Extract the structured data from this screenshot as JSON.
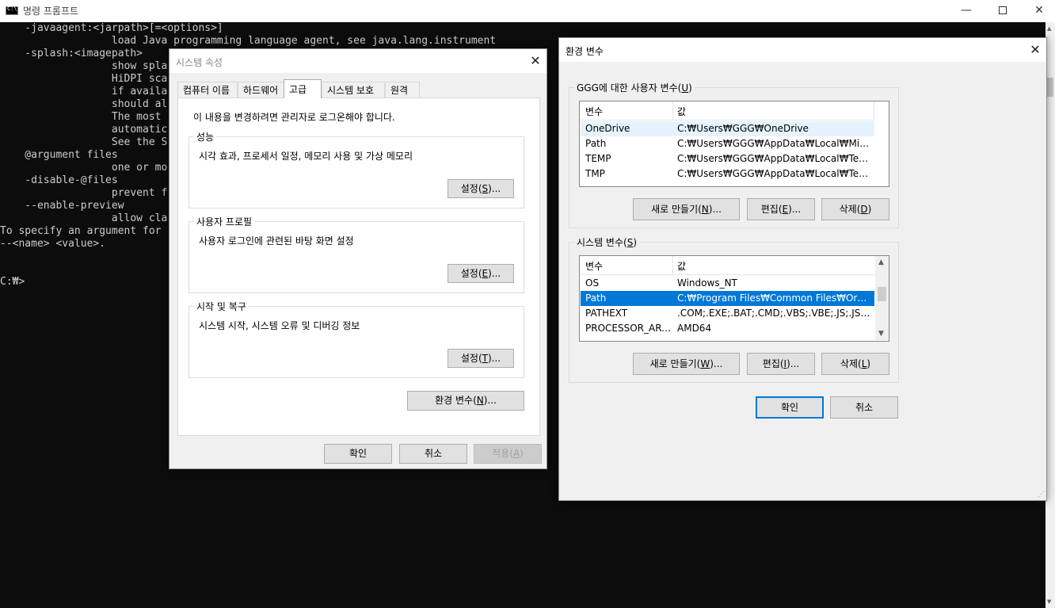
{
  "console": {
    "window_title": "명령 프롬프트",
    "minimize": "—",
    "close": "✕",
    "lines": [
      "    -javaagent:<jarpath>[=<options>]",
      "                  load Java programming language agent, see java.lang.instrument",
      "    -splash:<imagepath>",
      "                  show spla",
      "                  HiDPI sca",
      "                  if availa",
      "                  should al",
      "                  The most",
      "                  automatic",
      "                  See the S",
      "    @argument files",
      "                  one or mo",
      "    -disable-@files",
      "                  prevent f",
      "    --enable-preview",
      "                  allow cla",
      "To specify an argument for",
      "--<name> <value>.",
      "",
      "",
      "C:₩>"
    ]
  },
  "system_properties": {
    "title": "시스템 속성",
    "close": "✕",
    "tabs": [
      {
        "label": "컴퓨터 이름"
      },
      {
        "label": "하드웨어"
      },
      {
        "label": "고급"
      },
      {
        "label": "시스템 보호"
      },
      {
        "label": "원격"
      }
    ],
    "admin_note": "이 내용을 변경하려면 관리자로 로그온해야 합니다.",
    "groups": {
      "performance": {
        "title": "성능",
        "desc": "시각 효과, 프로세서 일정, 메모리 사용 및 가상 메모리",
        "btn_text": "설정(",
        "btn_key": "S",
        "btn_tail": ")..."
      },
      "user_profile": {
        "title": "사용자 프로필",
        "desc": "사용자 로그인에 관련된 바탕 화면 설정",
        "btn_text": "설정(",
        "btn_key": "E",
        "btn_tail": ")..."
      },
      "startup": {
        "title": "시작 및 복구",
        "desc": "시스템 시작, 시스템 오류 및 디버깅 정보",
        "btn_text": "설정(",
        "btn_key": "T",
        "btn_tail": ")..."
      }
    },
    "env_button": {
      "text": "환경 변수(",
      "key": "N",
      "tail": ")..."
    },
    "ok": "확인",
    "cancel": "취소",
    "apply": {
      "text": "적용(",
      "key": "A",
      "tail": ")"
    }
  },
  "environment_variables": {
    "title": "환경 변수",
    "close": "✕",
    "user_group": {
      "title": "GGG에 대한 사용자 변수(",
      "key": "U",
      "tail": ")"
    },
    "system_group": {
      "title": "시스템 변수(",
      "key": "S",
      "tail": ")"
    },
    "columns": {
      "name": "변수",
      "value": "값"
    },
    "user_vars": [
      {
        "name": "OneDrive",
        "value": "C:₩Users₩GGG₩OneDrive"
      },
      {
        "name": "Path",
        "value": "C:₩Users₩GGG₩AppData₩Local₩Microsoft..."
      },
      {
        "name": "TEMP",
        "value": "C:₩Users₩GGG₩AppData₩Local₩Temp"
      },
      {
        "name": "TMP",
        "value": "C:₩Users₩GGG₩AppData₩Local₩Temp"
      }
    ],
    "system_vars": [
      {
        "name": "OS",
        "value": "Windows_NT"
      },
      {
        "name": "Path",
        "value": "C:₩Program Files₩Common Files₩Oracle₩..."
      },
      {
        "name": "PATHEXT",
        "value": ".COM;.EXE;.BAT;.CMD;.VBS;.VBE;.JS;.JSE;.W..."
      },
      {
        "name": "PROCESSOR_ARC...",
        "value": "AMD64"
      }
    ],
    "user_buttons": {
      "new": {
        "text": "새로 만들기(",
        "key": "N",
        "tail": ")..."
      },
      "edit": {
        "text": "편집(",
        "key": "E",
        "tail": ")..."
      },
      "delete": {
        "text": "삭제(",
        "key": "D",
        "tail": ")"
      }
    },
    "system_buttons": {
      "new": {
        "text": "새로 만들기(",
        "key": "W",
        "tail": ")..."
      },
      "edit": {
        "text": "편집(",
        "key": "I",
        "tail": ")..."
      },
      "delete": {
        "text": "삭제(",
        "key": "L",
        "tail": ")"
      }
    },
    "ok": "확인",
    "cancel": "취소"
  }
}
